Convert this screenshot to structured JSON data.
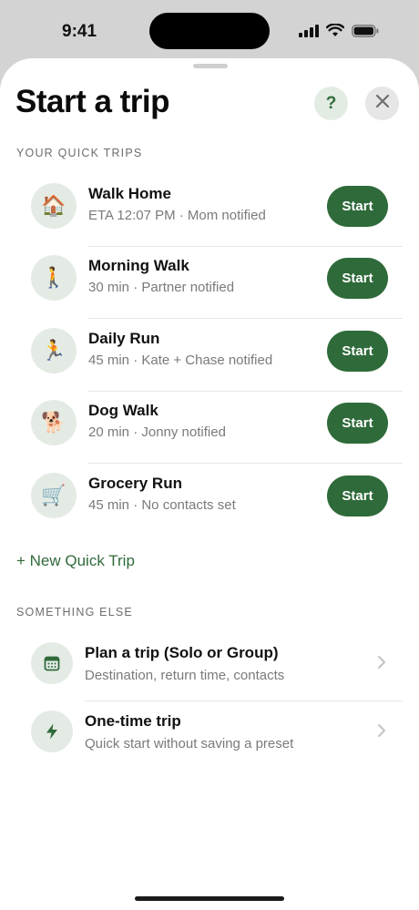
{
  "status_bar": {
    "time": "9:41"
  },
  "header": {
    "title": "Start a trip",
    "help_label": "?"
  },
  "quick_trips": {
    "section_label": "YOUR QUICK TRIPS",
    "start_label": "Start",
    "items": [
      {
        "emoji": "🏠",
        "icon": "house-icon",
        "name": "Walk Home",
        "detail": "ETA 12:07 PM · Mom notified"
      },
      {
        "emoji": "🚶",
        "icon": "walking-person-icon",
        "name": "Morning Walk",
        "detail": "30 min · Partner notified"
      },
      {
        "emoji": "🏃",
        "icon": "running-person-icon",
        "name": "Daily Run",
        "detail": "45 min · Kate + Chase notified"
      },
      {
        "emoji": "🐕",
        "icon": "dog-icon",
        "name": "Dog Walk",
        "detail": "20 min · Jonny notified"
      },
      {
        "emoji": "🛒",
        "icon": "shopping-cart-icon",
        "name": "Grocery Run",
        "detail": "45 min · No contacts set"
      }
    ],
    "new_label": "+ New Quick Trip"
  },
  "something_else": {
    "section_label": "SOMETHING ELSE",
    "items": [
      {
        "icon": "calendar-icon",
        "title": "Plan a trip (Solo or Group)",
        "subtitle": "Destination, return time, contacts"
      },
      {
        "icon": "lightning-bolt-icon",
        "title": "One-time trip",
        "subtitle": "Quick start without saving a preset"
      }
    ]
  },
  "colors": {
    "accent": "#2f6a3a",
    "accent_soft": "#e4ebe4"
  }
}
